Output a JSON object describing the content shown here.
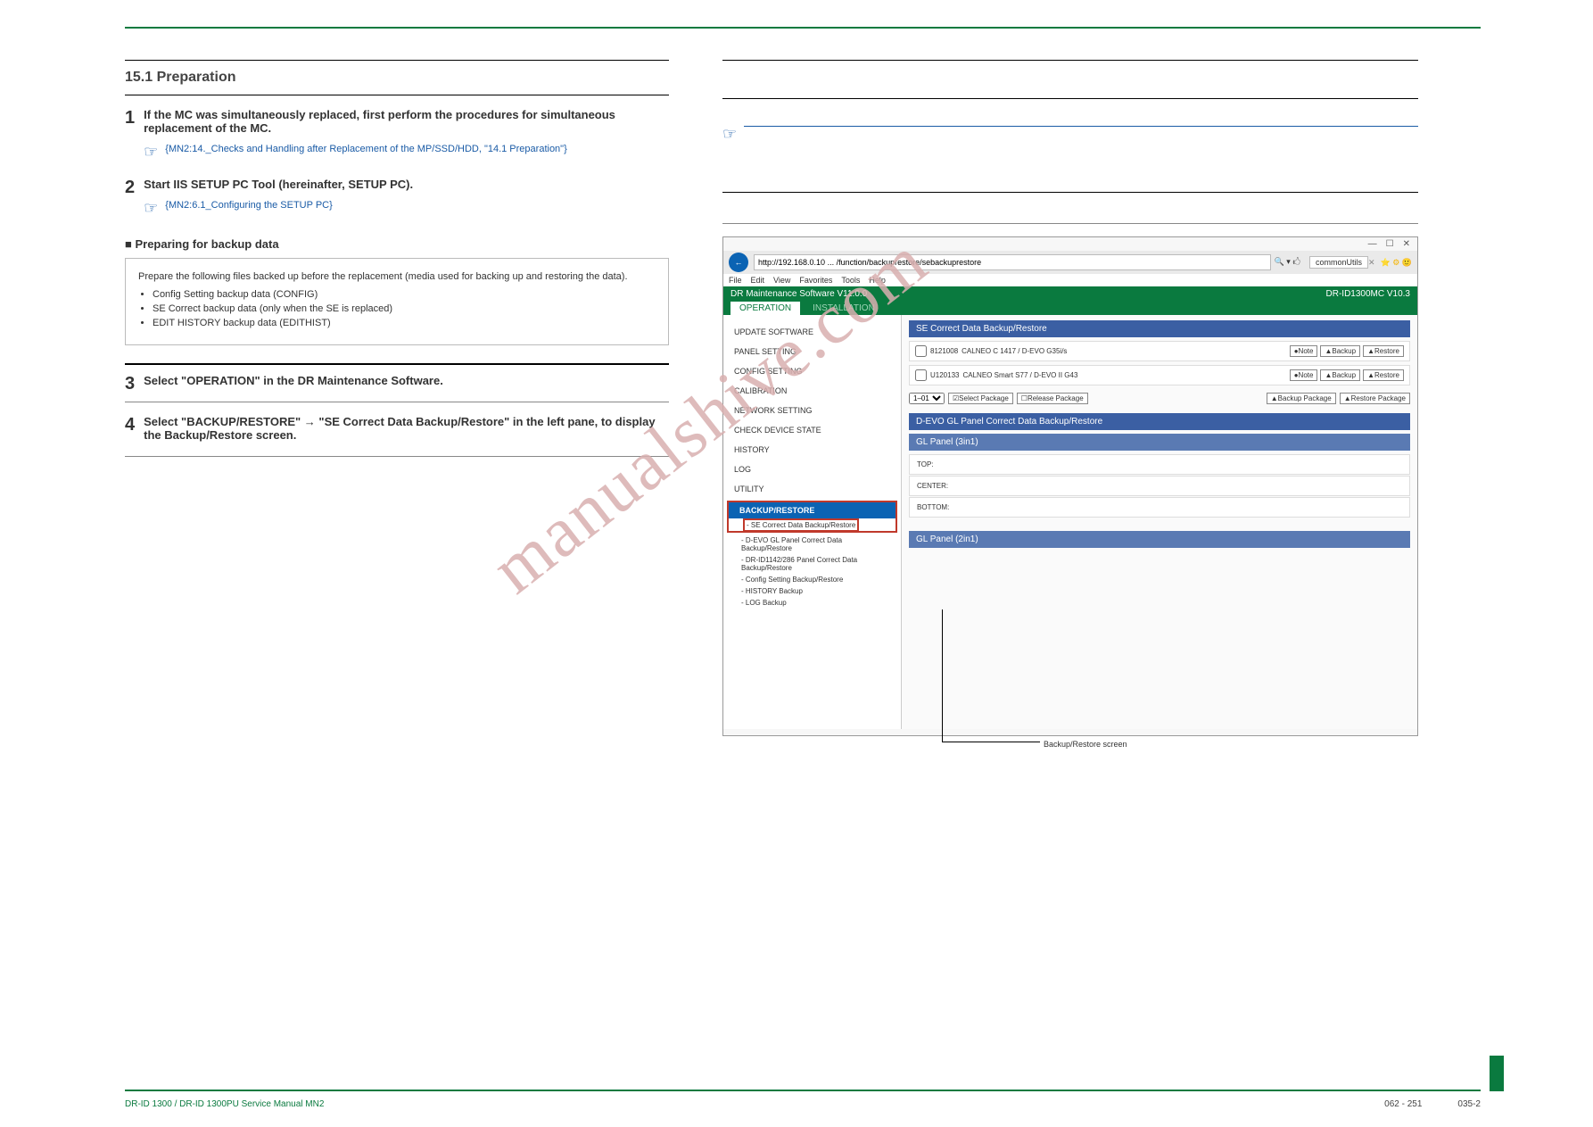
{
  "header": {
    "top_rule": true
  },
  "left": {
    "section_heading": "15.1  Preparation",
    "note_num": "1",
    "note_text": "If the MC was simultaneously replaced, first perform the procedures for simultaneous replacement of the MC.",
    "ref1_icon": "☞",
    "ref1_text": "{MN2:14._Checks and Handling after Replacement of the MP/SSD/HDD, \"14.1 Preparation\"}",
    "step2_num": "2",
    "step2_text": "Start IIS SETUP PC Tool (hereinafter, SETUP PC).",
    "ref2_icon": "☞",
    "ref2_text": "{MN2:6.1_Configuring the SETUP PC}",
    "section2_title": "■ Preparing for backup data",
    "well_lead": "Prepare the following files backed up before the replacement (media used for backing up and restoring the data).",
    "well_items": [
      "Config Setting backup data (CONFIG)",
      "SE Correct backup data (only when the SE is replaced)",
      "EDIT HISTORY backup data (EDITHIST)"
    ],
    "step3_num": "3",
    "step3_text": "Select \"OPERATION\" in the DR Maintenance Software.",
    "step4_num": "4",
    "step4_text": "Select \"BACKUP/RESTORE\" → \"SE Correct Data Backup/Restore\" in the left pane, to display the Backup/Restore screen."
  },
  "shot": {
    "addr_url": "http://192.168.0.10 ... /function/backuprestore/sebackuprestore",
    "addr_tab": "commonUtils",
    "menubar": [
      "File",
      "Edit",
      "View",
      "Favorites",
      "Tools",
      "Help"
    ],
    "green_title": "DR Maintenance Software V11.0.0",
    "green_right": "DR-ID1300MC V10.3",
    "tabs": [
      "OPERATION",
      "INSTALLATION"
    ],
    "sidebar_items": [
      "UPDATE SOFTWARE",
      "PANEL SETTING",
      "CONFIG SETTING",
      "CALIBRATION",
      "NETWORK SETTING",
      "CHECK DEVICE STATE",
      "HISTORY",
      "LOG",
      "UTILITY"
    ],
    "sidebar_selected_head": "BACKUP/RESTORE",
    "sidebar_sub_selected": "- SE Correct Data Backup/Restore",
    "sidebar_subs": [
      "- D-EVO GL Panel Correct Data Backup/Restore",
      "- DR-ID1142/286 Panel Correct Data Backup/Restore",
      "- Config Setting    Backup/Restore",
      "- HISTORY Backup",
      "- LOG Backup"
    ],
    "panel1_title": "SE Correct Data Backup/Restore",
    "row1_chk": "8121008",
    "row1_txt": "CALNEO C 1417 / D-EVO G35i/s",
    "row2_chk": "U120133",
    "row2_txt": "CALNEO Smart S77 / D-EVO II G43",
    "btn_note": "●Note",
    "btn_backup": "▲Backup",
    "btn_restore": "▲Restore",
    "toolbar_select": "1–01",
    "toolbar_selpkg": "☑Select Package",
    "toolbar_relpkg": "☐Release Package",
    "toolbar_bkpkg": "▲Backup Package",
    "toolbar_rspkg": "▲Restore Package",
    "panel2_title": "D-EVO GL Panel Correct Data Backup/Restore",
    "gl_head": "GL Panel (3in1)",
    "gl_slots": [
      "TOP:",
      "CENTER:",
      "BOTTOM:"
    ],
    "gl_head2": "GL Panel (2in1)",
    "caption": "Backup/Restore screen"
  },
  "watermark": "manualshive.com",
  "footer": {
    "left": "DR-ID 1300 / DR-ID 1300PU Service Manual  MN2",
    "right": "062 - 251",
    "code": "035-2"
  }
}
